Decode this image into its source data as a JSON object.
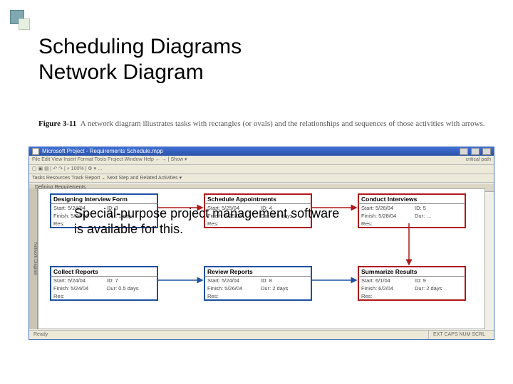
{
  "slide": {
    "title_line1": "Scheduling Diagrams",
    "title_line2": "Network Diagram",
    "figure_number": "Figure 3-11",
    "figure_caption_rest": "A network diagram illustrates tasks with rectangles (or ovals) and the relationships and sequences of those activities with arrows.",
    "overlay_text": "Special-purpose project management software is available for this."
  },
  "app": {
    "title": "Microsoft Project - Requirements Schedule.mpp",
    "toolbar1": "File  Edit  View  Insert  Format  Tools  Project  Window  Help     ← → | Show ▾",
    "toolbar1_right": "critical path",
    "toolbar2": "▢ ▣ ▤ | ↶ ↷ | ⌕ 100% | ⚙ ▾ …",
    "tabs": "Tasks  Resources  Track  Report   ⌄  Next Step and Related Activities ▾",
    "header_bar": "Defining Requirements",
    "vstrip": "Network Diagram",
    "status_left": "Ready",
    "status_right1": "EXT  CAPS  NUM  SCRL",
    "status_right2": ""
  },
  "nodes": {
    "n1": {
      "title": "Designing Interview Form",
      "start": "Start: 5/24/04",
      "id": "ID: 3",
      "finish": "Finish: 5/24/04",
      "dur": "Dur: 1 day",
      "res": "Res:"
    },
    "n2": {
      "title": "Schedule Appointments",
      "start": "Start: 5/25/04",
      "id": "ID: 4",
      "finish": "Finish: 5/25/04",
      "dur": "Dur: 0.5 days",
      "res": "Res:"
    },
    "n3": {
      "title": "Conduct Interviews",
      "start": "Start: 5/26/04",
      "id": "ID: 5",
      "finish": "Finish: 5/28/04",
      "dur": "Dur: …",
      "res": "Res:"
    },
    "n4": {
      "title": "Collect Reports",
      "start": "Start: 5/24/04",
      "id": "ID: 7",
      "finish": "Finish: 5/24/04",
      "dur": "Dur: 0.5 days",
      "res": "Res:"
    },
    "n5": {
      "title": "Review Reports",
      "start": "Start: 5/24/04",
      "id": "ID: 8",
      "finish": "Finish: 5/26/04",
      "dur": "Dur: 2 days",
      "res": "Res:"
    },
    "n6": {
      "title": "Summarize Results",
      "start": "Start: 6/1/04",
      "id": "ID: 9",
      "finish": "Finish: 6/2/04",
      "dur": "Dur: 2 days",
      "res": "Res:"
    }
  }
}
